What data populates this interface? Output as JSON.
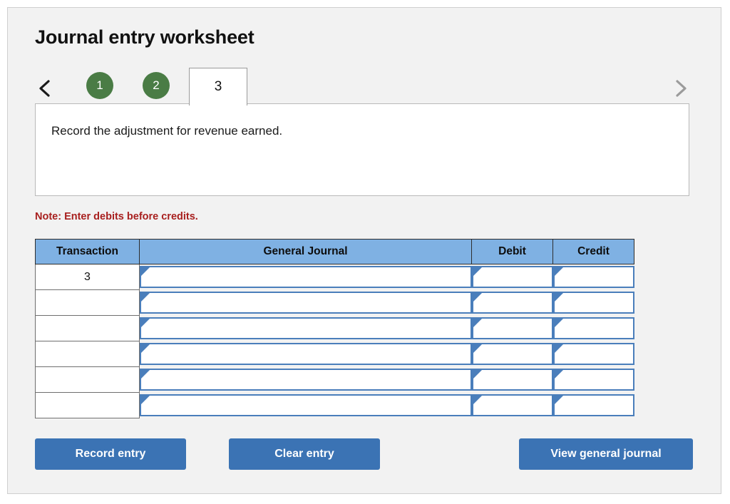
{
  "page": {
    "title": "Journal entry worksheet"
  },
  "tabs": {
    "prev_icon": "chevron-left-icon",
    "next_icon": "chevron-right-icon",
    "items": [
      {
        "label": "1",
        "state": "completed"
      },
      {
        "label": "2",
        "state": "completed"
      },
      {
        "label": "3",
        "state": "active"
      }
    ],
    "active_index": 2,
    "completed_color": "#4a7c45"
  },
  "instruction": {
    "text": "Record the adjustment for revenue earned."
  },
  "note": {
    "text": "Note: Enter debits before credits.",
    "color": "#a8201f"
  },
  "table": {
    "headers": {
      "transaction": "Transaction",
      "general_journal": "General Journal",
      "debit": "Debit",
      "credit": "Credit"
    },
    "header_bg": "#7fb1e3",
    "rows": [
      {
        "transaction": "3",
        "general_journal": "",
        "debit": "",
        "credit": ""
      },
      {
        "transaction": "",
        "general_journal": "",
        "debit": "",
        "credit": ""
      },
      {
        "transaction": "",
        "general_journal": "",
        "debit": "",
        "credit": ""
      },
      {
        "transaction": "",
        "general_journal": "",
        "debit": "",
        "credit": ""
      },
      {
        "transaction": "",
        "general_journal": "",
        "debit": "",
        "credit": ""
      },
      {
        "transaction": "",
        "general_journal": "",
        "debit": "",
        "credit": ""
      }
    ]
  },
  "buttons": {
    "record": "Record entry",
    "clear": "Clear entry",
    "view": "View general journal",
    "color": "#3b73b4"
  }
}
